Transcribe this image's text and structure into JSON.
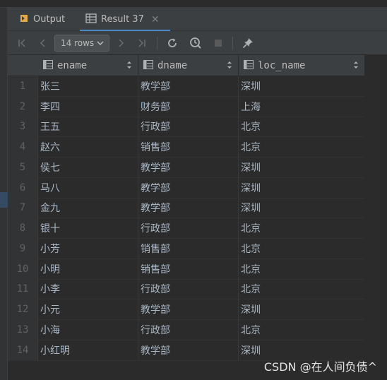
{
  "tabs": [
    {
      "label": "Output",
      "icon": "output-icon",
      "active": false
    },
    {
      "label": "Result 37",
      "icon": "table-icon",
      "active": true,
      "closable": true
    }
  ],
  "toolbar": {
    "rows_label": "14 rows",
    "buttons": [
      "first-page-icon",
      "prev-page-icon",
      "next-page-icon",
      "last-page-icon",
      "reload-icon",
      "history-icon",
      "stop-icon",
      "pin-icon"
    ]
  },
  "table": {
    "columns": [
      "ename",
      "dname",
      "loc_name"
    ],
    "rows": [
      {
        "n": "1",
        "ename": "张三",
        "dname": "教学部",
        "loc_name": "深圳"
      },
      {
        "n": "2",
        "ename": "李四",
        "dname": "财务部",
        "loc_name": "上海"
      },
      {
        "n": "3",
        "ename": "王五",
        "dname": "行政部",
        "loc_name": "北京"
      },
      {
        "n": "4",
        "ename": "赵六",
        "dname": "销售部",
        "loc_name": "北京"
      },
      {
        "n": "5",
        "ename": "侯七",
        "dname": "教学部",
        "loc_name": "深圳"
      },
      {
        "n": "6",
        "ename": "马八",
        "dname": "教学部",
        "loc_name": "深圳"
      },
      {
        "n": "7",
        "ename": "金九",
        "dname": "教学部",
        "loc_name": "深圳"
      },
      {
        "n": "8",
        "ename": "银十",
        "dname": "行政部",
        "loc_name": "北京"
      },
      {
        "n": "9",
        "ename": "小芳",
        "dname": "销售部",
        "loc_name": "北京"
      },
      {
        "n": "10",
        "ename": "小明",
        "dname": "销售部",
        "loc_name": "北京"
      },
      {
        "n": "11",
        "ename": "小李",
        "dname": "行政部",
        "loc_name": "北京"
      },
      {
        "n": "12",
        "ename": "小元",
        "dname": "教学部",
        "loc_name": "深圳"
      },
      {
        "n": "13",
        "ename": "小海",
        "dname": "行政部",
        "loc_name": "北京"
      },
      {
        "n": "14",
        "ename": "小红明",
        "dname": "教学部",
        "loc_name": "深圳"
      }
    ]
  },
  "watermark": "CSDN @在人间负债^",
  "colors": {
    "background": "#2b2b2b",
    "panel": "#3c3f41",
    "accent": "#4a88c7",
    "text": "#a9b7c6"
  }
}
